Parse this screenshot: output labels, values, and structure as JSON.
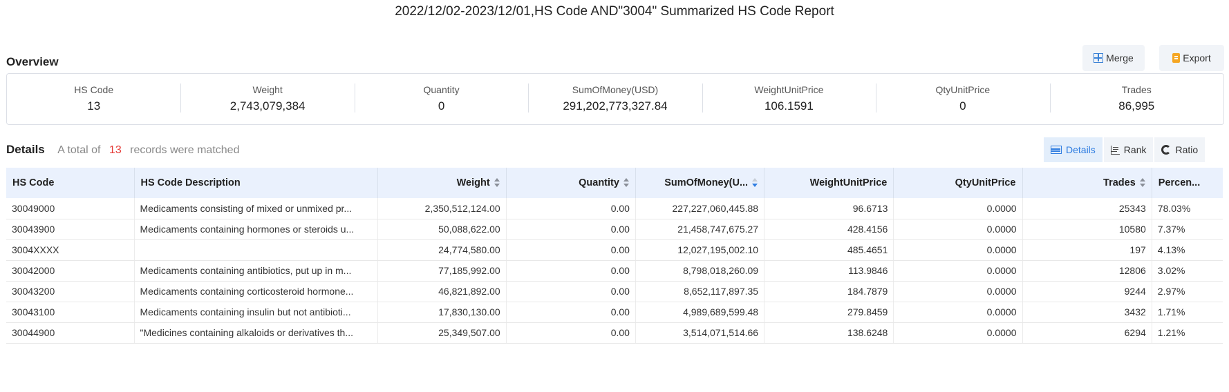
{
  "report": {
    "title": "2022/12/02-2023/12/01,HS Code AND\"3004\" Summarized HS Code Report"
  },
  "overview": {
    "label": "Overview",
    "merge_label": "Merge",
    "export_label": "Export",
    "summary": [
      {
        "label": "HS Code",
        "value": "13"
      },
      {
        "label": "Weight",
        "value": "2,743,079,384"
      },
      {
        "label": "Quantity",
        "value": "0"
      },
      {
        "label": "SumOfMoney(USD)",
        "value": "291,202,773,327.84"
      },
      {
        "label": "WeightUnitPrice",
        "value": "106.1591"
      },
      {
        "label": "QtyUnitPrice",
        "value": "0"
      },
      {
        "label": "Trades",
        "value": "86,995"
      }
    ]
  },
  "details": {
    "title": "Details",
    "prefix": "A total of",
    "count": "13",
    "suffix": "records were matched",
    "views": {
      "details": "Details",
      "rank": "Rank",
      "ratio": "Ratio"
    },
    "columns": {
      "hs_code": "HS Code",
      "description": "HS Code Description",
      "weight": "Weight",
      "quantity": "Quantity",
      "sum_of_money": "SumOfMoney(U...",
      "weight_unit_price": "WeightUnitPrice",
      "qty_unit_price": "QtyUnitPrice",
      "trades": "Trades",
      "percent": "Percen..."
    },
    "rows": [
      {
        "hs_code": "30049000",
        "description": "Medicaments consisting of mixed or unmixed pr...",
        "weight": "2,350,512,124.00",
        "quantity": "0.00",
        "sum": "227,227,060,445.88",
        "wup": "96.6713",
        "qup": "0.0000",
        "trades": "25343",
        "percent": "78.03%"
      },
      {
        "hs_code": "30043900",
        "description": "Medicaments containing hormones or steroids u...",
        "weight": "50,088,622.00",
        "quantity": "0.00",
        "sum": "21,458,747,675.27",
        "wup": "428.4156",
        "qup": "0.0000",
        "trades": "10580",
        "percent": "7.37%"
      },
      {
        "hs_code": "3004XXXX",
        "description": "",
        "weight": "24,774,580.00",
        "quantity": "0.00",
        "sum": "12,027,195,002.10",
        "wup": "485.4651",
        "qup": "0.0000",
        "trades": "197",
        "percent": "4.13%"
      },
      {
        "hs_code": "30042000",
        "description": "Medicaments containing antibiotics, put up in m...",
        "weight": "77,185,992.00",
        "quantity": "0.00",
        "sum": "8,798,018,260.09",
        "wup": "113.9846",
        "qup": "0.0000",
        "trades": "12806",
        "percent": "3.02%"
      },
      {
        "hs_code": "30043200",
        "description": "Medicaments containing corticosteroid hormone...",
        "weight": "46,821,892.00",
        "quantity": "0.00",
        "sum": "8,652,117,897.35",
        "wup": "184.7879",
        "qup": "0.0000",
        "trades": "9244",
        "percent": "2.97%"
      },
      {
        "hs_code": "30043100",
        "description": "Medicaments containing insulin but not antibioti...",
        "weight": "17,830,130.00",
        "quantity": "0.00",
        "sum": "4,989,689,599.48",
        "wup": "279.8459",
        "qup": "0.0000",
        "trades": "3432",
        "percent": "1.71%"
      },
      {
        "hs_code": "30044900",
        "description": "\"Medicines containing alkaloids or derivatives th...",
        "weight": "25,349,507.00",
        "quantity": "0.00",
        "sum": "3,514,071,514.66",
        "wup": "138.6248",
        "qup": "0.0000",
        "trades": "6294",
        "percent": "1.21%"
      }
    ]
  }
}
